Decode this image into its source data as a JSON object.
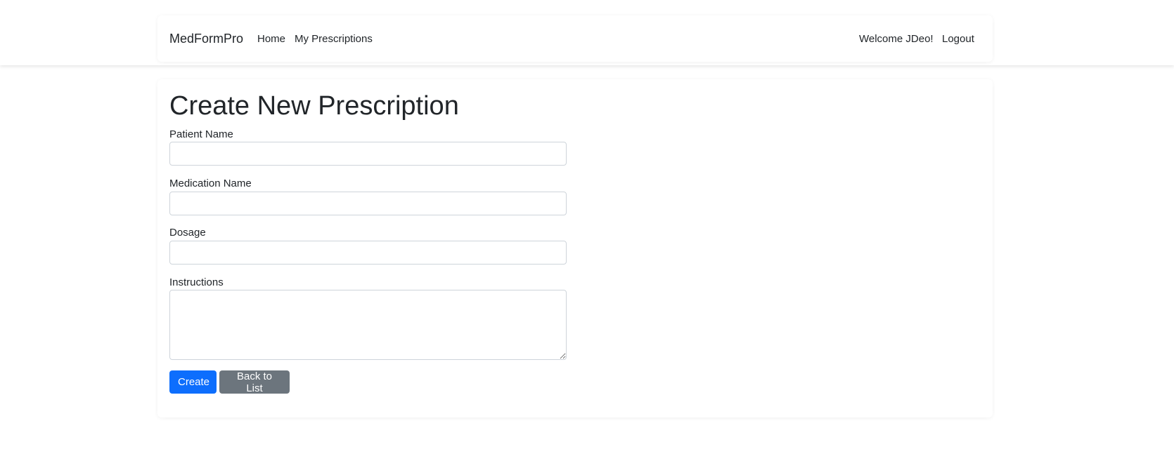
{
  "navbar": {
    "brand": "MedFormPro",
    "links": [
      {
        "label": "Home"
      },
      {
        "label": "My Prescriptions"
      }
    ],
    "welcome": "Welcome JDeo!",
    "logout": "Logout"
  },
  "form": {
    "title": "Create New Prescription",
    "fields": {
      "patient_name": {
        "label": "Patient Name",
        "value": ""
      },
      "medication_name": {
        "label": "Medication Name",
        "value": ""
      },
      "dosage": {
        "label": "Dosage",
        "value": ""
      },
      "instructions": {
        "label": "Instructions",
        "value": ""
      }
    },
    "create_label": "Create",
    "back_label": "Back to List"
  },
  "colors": {
    "primary": "#0d6efd",
    "secondary": "#6c757d",
    "text": "#212529",
    "border": "#ced4da"
  }
}
